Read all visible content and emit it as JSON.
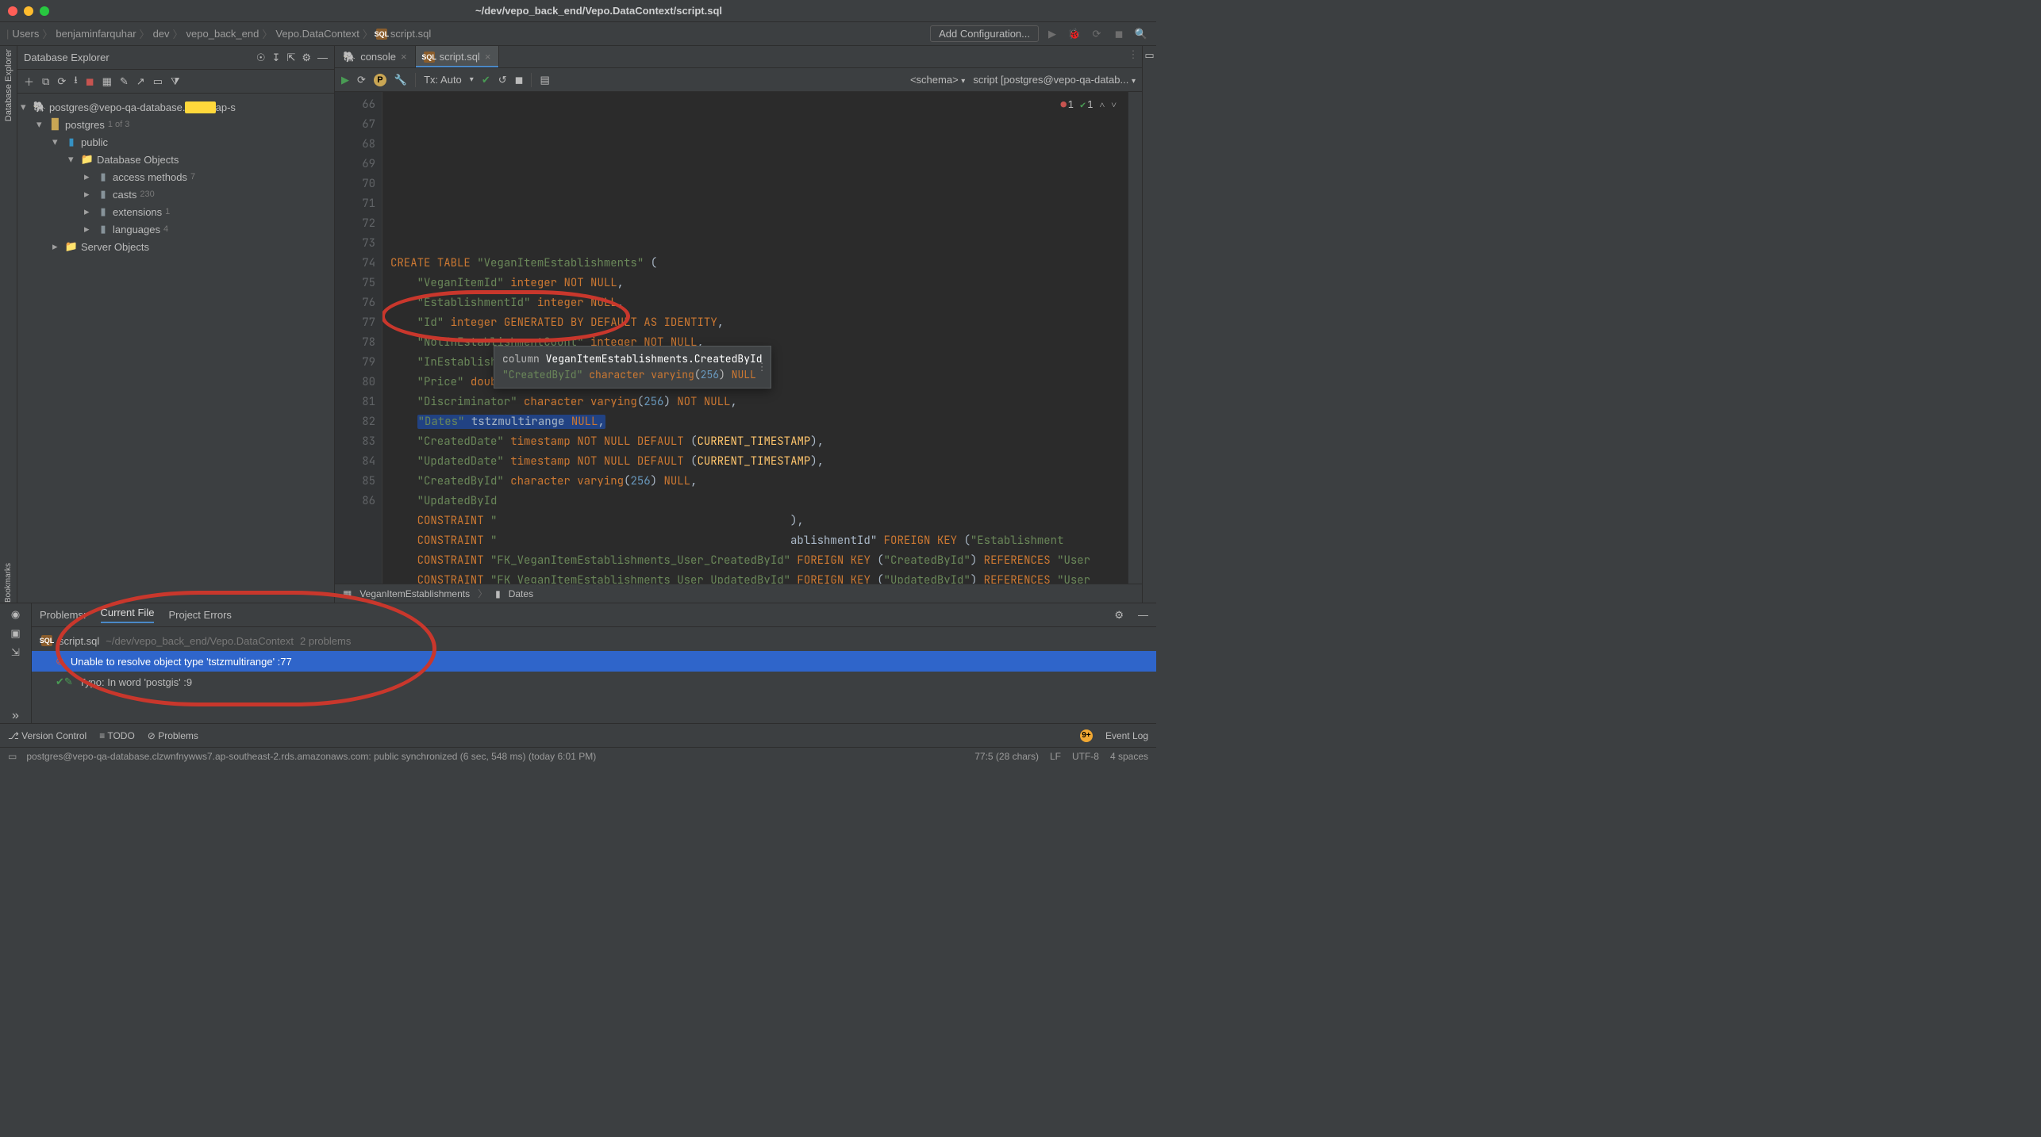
{
  "title": "~/dev/vepo_back_end/Vepo.DataContext/script.sql",
  "breadcrumbs": [
    "Users",
    "benjaminfarquhar",
    "dev",
    "vepo_back_end",
    "Vepo.DataContext",
    "script.sql"
  ],
  "add_config": "Add Configuration...",
  "db_panel": {
    "title": "Database Explorer",
    "conn": "postgres@vepo-qa-database.",
    "conn_suffix": "ap-s",
    "db": "postgres",
    "db_dim": "1 of 3",
    "schema": "public",
    "obj_title": "Database Objects",
    "items": [
      {
        "label": "access methods",
        "count": "7"
      },
      {
        "label": "casts",
        "count": "230"
      },
      {
        "label": "extensions",
        "count": "1"
      },
      {
        "label": "languages",
        "count": "4"
      }
    ],
    "server": "Server Objects"
  },
  "tabs": [
    {
      "label": "console",
      "active": false
    },
    {
      "label": "script.sql",
      "active": true
    }
  ],
  "ed_toolbar": {
    "tx": "Tx: Auto",
    "schema": "<schema>",
    "target": "script [postgres@vepo-qa-datab..."
  },
  "indicators": {
    "errors": "1",
    "ok": "1"
  },
  "gutter_start": 66,
  "code_lines": [
    "",
    "",
    "",
    {
      "ln": 69,
      "html": "<span class='kw'>CREATE</span> <span class='kw'>TABLE</span> <span class='str'>\"VeganItemEstablishments\"</span> <span class='ident'>(</span>"
    },
    {
      "ln": 70,
      "html": "    <span class='str'>\"VeganItemId\"</span> <span class='kw'>integer</span> <span class='kw'>NOT</span> <span class='kw'>NULL</span>,"
    },
    {
      "ln": 71,
      "html": "    <span class='str'>\"EstablishmentId\"</span> <span class='kw'>integer</span> <span class='kw'>NULL</span>,"
    },
    {
      "ln": 72,
      "html": "    <span class='str'>\"Id\"</span> <span class='kw'>integer</span> <span class='kw'>GENERATED</span> <span class='kw'>BY</span> <span class='kw'>DEFAULT</span> <span class='kw'>AS</span> <span class='kw'>IDENTITY</span>,"
    },
    {
      "ln": 73,
      "html": "    <span class='str'>\"NotInEstablishmentCount\"</span> <span class='kw'>integer</span> <span class='kw'>NOT</span> <span class='kw'>NULL</span>,"
    },
    {
      "ln": 74,
      "html": "    <span class='str'>\"InEstablishmentCount\"</span> <span class='kw'>integer</span> <span class='kw'>NOT</span> <span class='kw'>NULL</span>,"
    },
    {
      "ln": 75,
      "html": "    <span class='str'>\"Price\"</span> <span class='kw'>double precision</span> <span class='kw'>NOT</span> <span class='kw'>NULL</span>,"
    },
    {
      "ln": 76,
      "html": "    <span class='str'>\"Discriminator\"</span> <span class='kw'>character varying</span>(<span class='num'>256</span>) <span class='kw'>NOT</span> <span class='kw'>NULL</span>,"
    },
    {
      "ln": 77,
      "html": "    <span class='sel-word'><span class='str'>\"Dates\"</span> tstzmultirange <span class='kw'>NULL</span>,</span>"
    },
    {
      "ln": 78,
      "html": "    <span class='str'>\"CreatedDate\"</span> <span class='kw'>timestamp</span> <span class='kw'>NOT</span> <span class='kw'>NULL</span> <span class='kw'>DEFAULT</span> (<span class='fn'>CURRENT_TIMESTAMP</span>),"
    },
    {
      "ln": 79,
      "html": "    <span class='str'>\"UpdatedDate\"</span> <span class='kw'>timestamp</span> <span class='kw'>NOT</span> <span class='kw'>NULL</span> <span class='kw'>DEFAULT</span> (<span class='fn'>CURRENT_TIMESTAMP</span>),"
    },
    {
      "ln": 80,
      "html": "    <span class='str'>\"CreatedById\"</span> <span class='kw'>character varying</span>(<span class='num'>256</span>) <span class='kw'>NULL</span>,"
    },
    {
      "ln": 81,
      "html": "    <span class='str'>\"UpdatedById</span>"
    },
    {
      "ln": 82,
      "html": "    <span class='kw'>CONSTRAINT</span> <span class='str'>\"</span>                                            <span class='ident'>),</span>"
    },
    {
      "ln": 83,
      "html": "    <span class='kw'>CONSTRAINT</span> <span class='str'>\"</span>                                            <span class='ident'>ablishmentId\"</span> <span class='kw'>FOREIGN</span> <span class='kw'>KEY</span> (<span class='str'>\"Establishment</span>"
    },
    {
      "ln": 84,
      "html": "    <span class='kw'>CONSTRAINT</span> <span class='str'>\"FK_VeganItemEstablishments_User_CreatedById\"</span> <span class='kw'>FOREIGN</span> <span class='kw'>KEY</span> (<span class='str'>\"CreatedById\"</span>) <span class='kw'>REFERENCES</span> <span class='str'>\"User</span>"
    },
    {
      "ln": 85,
      "html": "    <span class='kw'>CONSTRAINT</span> <span class='str'>\"FK_VeganItemEstablishments_User_UpdatedById\"</span> <span class='kw'>FOREIGN</span> <span class='kw'>KEY</span> (<span class='str'>\"UpdatedById\"</span>) <span class='kw'>REFERENCES</span> <span class='str'>\"User</span>"
    },
    {
      "ln": 86,
      "html": ""
    }
  ],
  "tooltip": {
    "l1_a": "column ",
    "l1_b": "VeganItemEstablishments.CreatedById",
    "l2": "\"CreatedById\" character varying(256) NULL"
  },
  "bc_bottom": [
    "VeganItemEstablishments",
    "Dates"
  ],
  "problems": {
    "title": "Problems:",
    "tabs": [
      "Current File",
      "Project Errors"
    ],
    "file": "script.sql",
    "file_path": "~/dev/vepo_back_end/Vepo.DataContext",
    "count": "2 problems",
    "err": "Unable to resolve object type 'tstzmultirange' :77",
    "warn": "Typo: In word 'postgis' :9"
  },
  "bottom_tools": {
    "vcs": "Version Control",
    "todo": "TODO",
    "problems": "Problems",
    "eventlog": "Event Log"
  },
  "status": {
    "left": "postgres@vepo-qa-database.clzwnfnywws7.ap-southeast-2.rds.amazonaws.com: public synchronized (6 sec, 548 ms) (today 6:01 PM)",
    "pos": "77:5 (28 chars)",
    "le": "LF",
    "enc": "UTF-8",
    "indent": "4 spaces"
  }
}
